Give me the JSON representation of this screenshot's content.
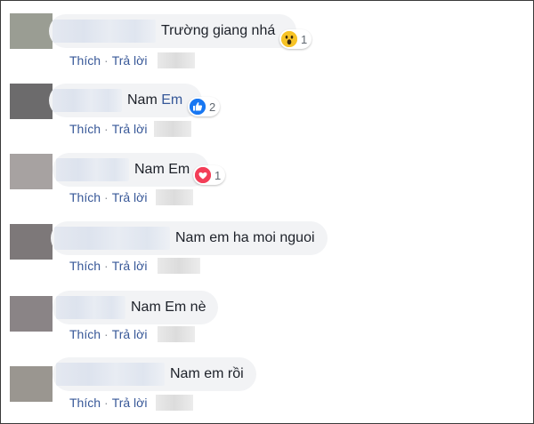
{
  "comments": [
    {
      "text": "Trường giang nhá",
      "reaction": {
        "icon": "wow-icon",
        "count": "1"
      },
      "like_label": "Thích",
      "reply_label": "Trả lời",
      "avatar_color": "#9a9d93"
    },
    {
      "text_pre": "Nam ",
      "text_link": "Em",
      "reaction": {
        "icon": "like-icon",
        "count": "2",
        "color": "#1877f2"
      },
      "like_label": "Thích",
      "reply_label": "Trả lời",
      "avatar_color": "#6c6b6c"
    },
    {
      "text": "Nam Em",
      "reaction": {
        "icon": "love-icon",
        "count": "1",
        "color": "#f33e58"
      },
      "like_label": "Thích",
      "reply_label": "Trả lời",
      "avatar_color": "#a7a2a1"
    },
    {
      "text": "Nam em ha moi nguoi",
      "like_label": "Thích",
      "reply_label": "Trả lời",
      "avatar_color": "#7d7879"
    },
    {
      "text": "Nam Em nè",
      "like_label": "Thích",
      "reply_label": "Trả lời",
      "avatar_color": "#8a8486"
    },
    {
      "text": "Nam em rồi",
      "like_label": "Thích",
      "reply_label": "Trả lời",
      "avatar_color": "#9a9690"
    }
  ]
}
